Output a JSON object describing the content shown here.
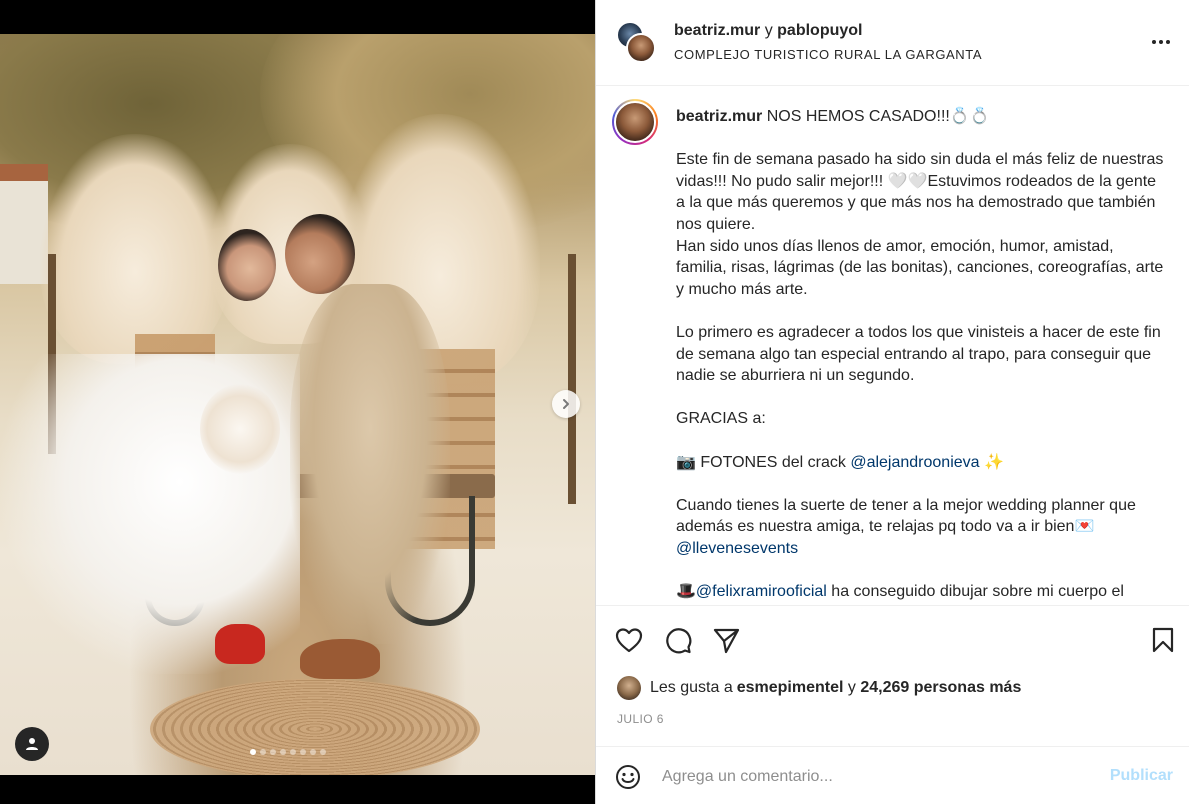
{
  "post": {
    "media": {
      "carousel_total": 8,
      "carousel_active": 1
    },
    "header": {
      "user1": "beatriz.mur",
      "conjunction": "y",
      "user2": "pablopuyol",
      "location": "COMPLEJO TURISTICO RURAL LA GARGANTA"
    },
    "caption": {
      "username": "beatriz.mur",
      "title": " NOS HEMOS CASADO!!!💍💍",
      "p1": "Este fin de semana pasado ha sido sin duda el más feliz de nuestras vidas!!! No pudo salir mejor!!! 🤍🤍Estuvimos rodeados de la gente a la que más queremos y que más nos ha demostrado que también nos quiere.",
      "p2": "Han sido unos días llenos de amor, emoción, humor, amistad, familia, risas, lágrimas (de las bonitas), canciones, coreografías, arte y mucho más arte.",
      "p3": "Lo primero es agradecer a todos los que vinisteis a hacer de este fin de semana algo tan especial entrando al trapo, para conseguir que nadie se aburriera ni un segundo.",
      "p4": "GRACIAS a:",
      "p5_emoji": "📷",
      "p5_text": " FOTONES del crack ",
      "p5_mention": "@alejandroonieva",
      "p5_tail": " ✨",
      "p6_text": "Cuando tienes la suerte de tener a la mejor wedding planner que además es nuestra amiga, te relajas pq todo va a ir bien💌",
      "p6_mention": "@llevenesevents",
      "p7_emoji": "🎩",
      "p7_mention": "@felixramirooficial",
      "p7_text": " ha conseguido dibujar sobre mi cuerpo el"
    },
    "likes": {
      "prefix": "Les gusta a ",
      "user": "esmepimentel",
      "middle": " y ",
      "count": "24,269 personas más"
    },
    "date": "JULIO 6",
    "comment": {
      "placeholder": "Agrega un comentario...",
      "publish_label": "Publicar"
    },
    "icons": {
      "more": "more-horizontal-icon",
      "like": "heart-icon",
      "comment": "comment-icon",
      "share": "share-icon",
      "save": "bookmark-icon",
      "emoji": "emoji-icon",
      "next": "chevron-right-icon",
      "tag": "user-tag-icon"
    },
    "colors": {
      "mention": "#00376b",
      "publish_disabled": "#b2dffc",
      "muted": "#8e8e8e"
    }
  }
}
